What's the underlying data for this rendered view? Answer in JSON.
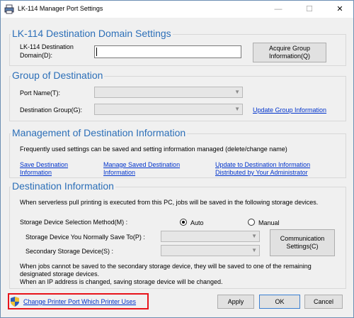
{
  "window": {
    "title": "LK-114 Manager Port Settings",
    "minimize": "—",
    "maximize": "☐",
    "close": "✕"
  },
  "domain": {
    "title": "LK-114 Destination Domain Settings",
    "label_line1": "LK-114 Destination",
    "label_line2": "Domain(D):",
    "value": "",
    "acquire_line1": "Acquire Group",
    "acquire_line2": "Information(Q)"
  },
  "group": {
    "title": "Group of Destination",
    "port_label": "Port Name(T):",
    "port_value": "",
    "dest_label": "Destination Group(G):",
    "dest_value": "",
    "update_link": "Update Group Information"
  },
  "management": {
    "title": "Management of Destination Information",
    "description": "Frequently used settings can be saved and setting information managed (delete/change name)",
    "save_line1": "Save Destination",
    "save_line2": "Information",
    "manage_line1": "Manage Saved Destination",
    "manage_line2": "Information",
    "update_line1": "Update to Destination Information",
    "update_line2": "Distributed by Your Administrator"
  },
  "destination": {
    "title": "Destination Information",
    "description": "When serverless pull printing is executed from this PC, jobs will be saved in the following storage devices.",
    "method_label": "Storage Device Selection Method(M) :",
    "auto_label": "Auto",
    "manual_label": "Manual",
    "selected": "auto",
    "normal_label": "Storage Device You Normally Save To(P) :",
    "normal_value": "",
    "secondary_label": "Secondary Storage Device(S) :",
    "secondary_value": "",
    "comm_line1": "Communication",
    "comm_line2": "Settings(C)",
    "note_line1": "When jobs cannot be saved to the secondary storage device, they will be saved to one of the remaining",
    "note_line2": "designated  storage devices.",
    "note_line3": "When an IP address is changed, saving storage device will be changed."
  },
  "footer": {
    "change_port_link": "Change Printer Port Which Printer Uses",
    "apply": "Apply",
    "ok": "OK",
    "cancel": "Cancel"
  },
  "colors": {
    "section_title": "#2c6fb8",
    "link": "#0033cc",
    "highlight": "#e8141a"
  }
}
